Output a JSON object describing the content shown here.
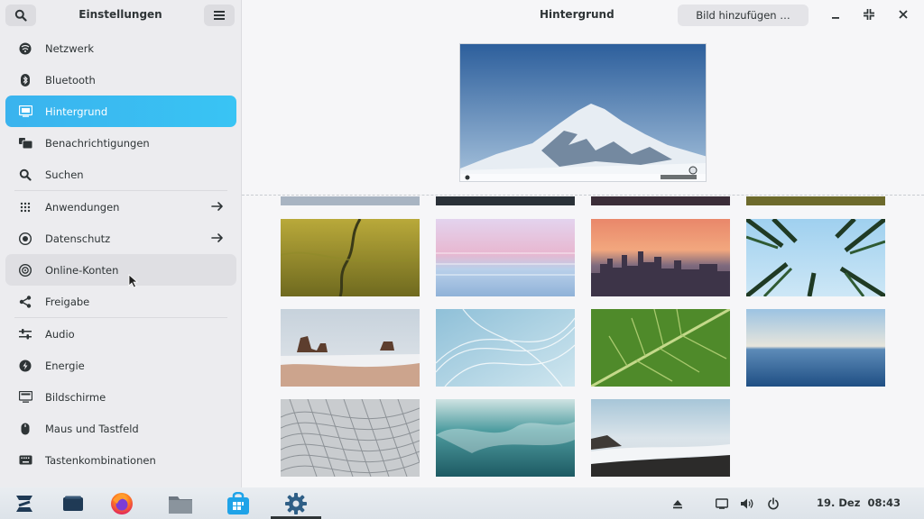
{
  "sidebar": {
    "title": "Einstellungen",
    "items": [
      {
        "label": "Netzwerk",
        "icon": "network-icon"
      },
      {
        "label": "Bluetooth",
        "icon": "bluetooth-icon"
      },
      {
        "label": "Hintergrund",
        "icon": "background-icon",
        "active": true
      },
      {
        "label": "Benachrichtigungen",
        "icon": "notifications-icon"
      },
      {
        "label": "Suchen",
        "icon": "search-icon"
      },
      {
        "label": "Anwendungen",
        "icon": "apps-grid-icon",
        "arrow": true
      },
      {
        "label": "Datenschutz",
        "icon": "privacy-icon",
        "arrow": true
      },
      {
        "label": "Online-Konten",
        "icon": "online-accounts-icon",
        "hover": true
      },
      {
        "label": "Freigabe",
        "icon": "share-icon"
      },
      {
        "label": "Audio",
        "icon": "audio-sliders-icon"
      },
      {
        "label": "Energie",
        "icon": "power-icon"
      },
      {
        "label": "Bildschirme",
        "icon": "display-icon"
      },
      {
        "label": "Maus und Tastfeld",
        "icon": "mouse-icon"
      },
      {
        "label": "Tastenkombinationen",
        "icon": "keyboard-icon"
      }
    ]
  },
  "header": {
    "title": "Hintergrund",
    "add_label": "Bild hinzufügen …"
  },
  "taskbar": {
    "apps": [
      "zorin-menu-icon",
      "window-switcher-icon",
      "firefox-icon",
      "files-icon",
      "software-store-icon",
      "settings-gear-icon"
    ],
    "tray": [
      "eject-icon",
      "screen-icon",
      "volume-icon",
      "power-icon"
    ],
    "date": "19. Dez",
    "time": "08:43"
  },
  "colors": {
    "accent": "#3ab3ee",
    "sidebar_bg": "#ececef",
    "content_bg": "#f6f6f8"
  }
}
